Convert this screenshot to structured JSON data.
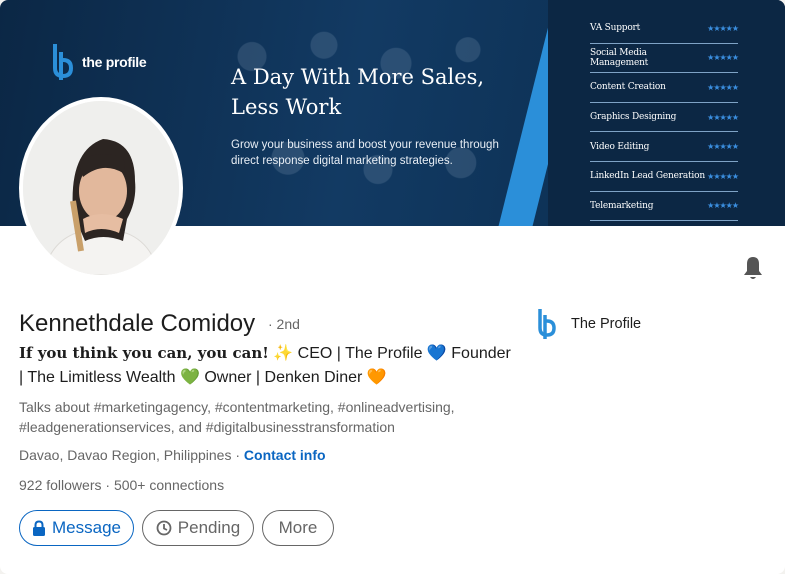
{
  "banner": {
    "brand": "the profile",
    "headline_line1": "A Day With More Sales,",
    "headline_line2": "Less Work",
    "subline": "Grow your business and boost your revenue through direct response digital marketing strategies.",
    "services": [
      {
        "label": "VA Support",
        "rating": "★★★★★"
      },
      {
        "label": "Social Media Management",
        "rating": "★★★★★"
      },
      {
        "label": "Content Creation",
        "rating": "★★★★★"
      },
      {
        "label": "Graphics Designing",
        "rating": "★★★★★"
      },
      {
        "label": "Video Editing",
        "rating": "★★★★★"
      },
      {
        "label": "LinkedIn Lead Generation",
        "rating": "★★★★★"
      },
      {
        "label": "Telemarketing",
        "rating": "★★★★★"
      }
    ]
  },
  "profile": {
    "name": "Kennethdale Comidoy",
    "degree": "· 2nd",
    "tagline_bold": "If you think you can, you can!",
    "tagline_rest1": " CEO | The Profile ",
    "tagline_rest2": " Founder | The Limitless Wealth ",
    "tagline_rest3": " Owner | Denken Diner ",
    "talks_about": "Talks about #marketingagency, #contentmarketing, #onlineadvertising, #leadgenerationservices, and #digitalbusinesstransformation",
    "location": "Davao, Davao Region, Philippines",
    "location_sep": " · ",
    "contact_label": "Contact info",
    "followers": "922 followers",
    "connections": "500+ connections",
    "stats_sep": " · "
  },
  "company": {
    "name": "The Profile"
  },
  "actions": {
    "message_label": "Message",
    "pending_label": "Pending",
    "more_label": "More"
  },
  "colors": {
    "accent": "#0a66c2",
    "banner_dark": "#0b2745",
    "brand_blue": "#2b8fd9"
  },
  "icons": {
    "bell": "bell-icon",
    "lock": "lock-icon",
    "clock": "clock-icon",
    "sparkles": "sparkles-icon",
    "blue_heart": "blue-heart-icon",
    "green_heart": "green-heart-icon",
    "orange_heart": "orange-heart-icon"
  }
}
